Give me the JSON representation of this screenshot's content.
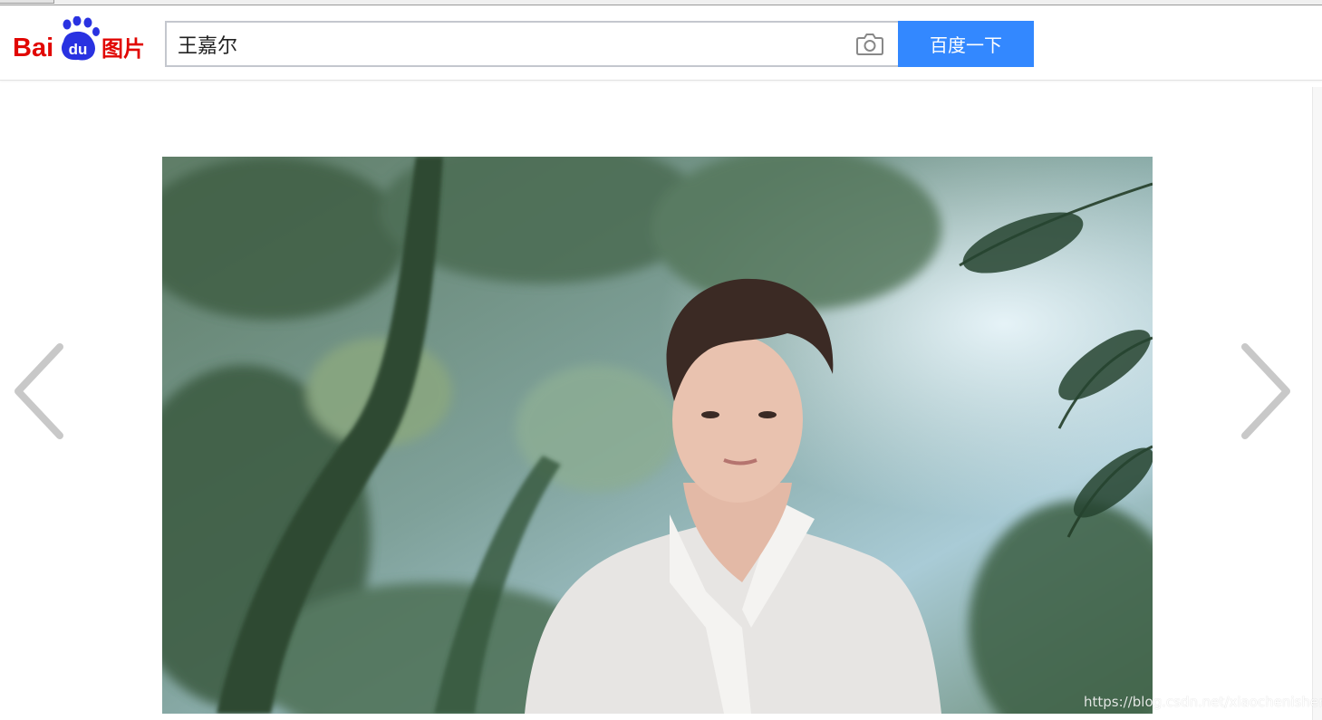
{
  "header": {
    "logo": {
      "text_part1": "Bai",
      "text_part2": "du",
      "text_part3": "图片"
    },
    "search": {
      "value": "王嘉尔",
      "placeholder": ""
    },
    "search_button_label": "百度一下"
  },
  "viewer": {
    "prev_icon": "chevron-left-icon",
    "next_icon": "chevron-right-icon"
  },
  "watermark": "https://blog.csdn.net/xiaochenishere",
  "colors": {
    "brand_red": "#e10602",
    "brand_blue": "#2932e1",
    "button_blue": "#3388ff",
    "arrow_gray": "#c8c8c8"
  }
}
